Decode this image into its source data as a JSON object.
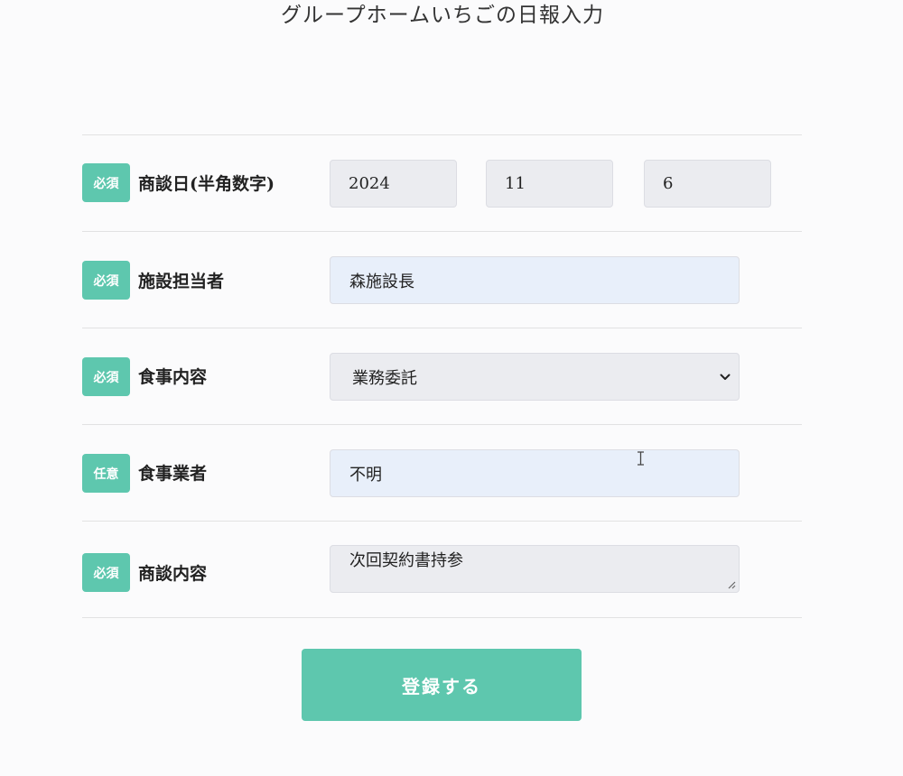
{
  "page": {
    "title": "グループホームいちごの日報入力"
  },
  "colors": {
    "accent": "#5ec7ae",
    "input_blue": "#e8effa",
    "input_gray": "#ebecf0"
  },
  "form": {
    "rows": [
      {
        "badge": "必須",
        "label": "商談日(半角数字)",
        "year": "2024",
        "month": "11",
        "day": "6"
      },
      {
        "badge": "必須",
        "label": "施設担当者",
        "value": "森施設長"
      },
      {
        "badge": "必須",
        "label": "食事内容",
        "selected": "業務委託",
        "icon": "chevron-down-icon"
      },
      {
        "badge": "任意",
        "label": "食事業者",
        "value": "不明"
      },
      {
        "badge": "必須",
        "label": "商談内容",
        "value": "次回契約書持参"
      }
    ]
  },
  "submit": {
    "label": "登録する"
  }
}
